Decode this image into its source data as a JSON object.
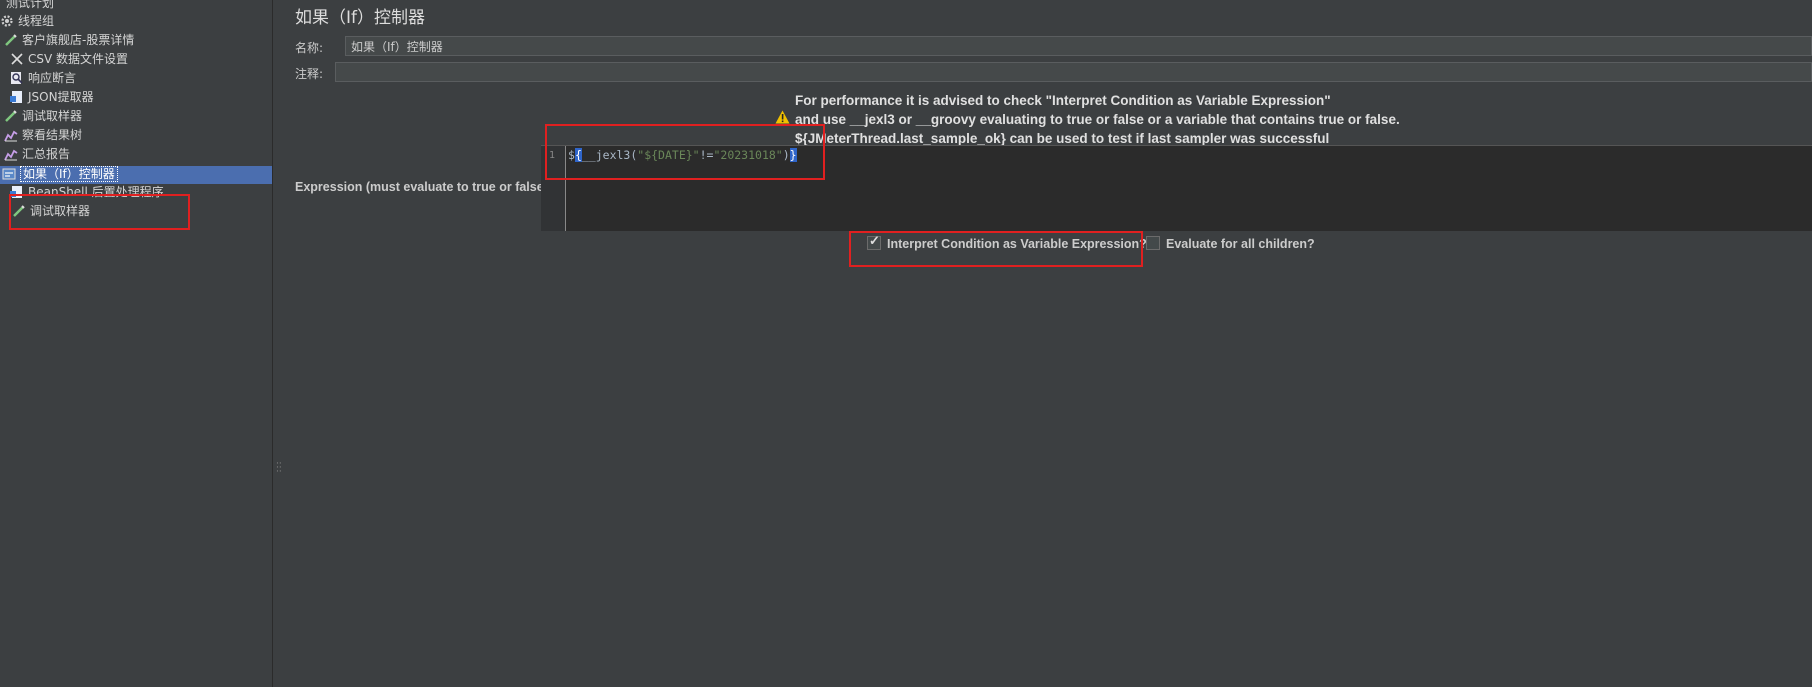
{
  "tree": {
    "items": [
      {
        "label": "测试计划",
        "icon": "test-plan-icon"
      },
      {
        "label": "线程组",
        "icon": "gear-icon"
      },
      {
        "label": "客户旗舰店-股票详情",
        "icon": "pipette-icon"
      },
      {
        "label": "CSV 数据文件设置",
        "icon": "scissors-icon"
      },
      {
        "label": "响应断言",
        "icon": "magnifier-icon"
      },
      {
        "label": "JSON提取器",
        "icon": "document-icon"
      },
      {
        "label": "调试取样器",
        "icon": "pipette-icon"
      },
      {
        "label": "察看结果树",
        "icon": "chart-icon"
      },
      {
        "label": "汇总报告",
        "icon": "chart-icon"
      },
      {
        "label": "如果（If）控制器",
        "icon": "if-controller-icon",
        "selected": true
      },
      {
        "label": "BeanShell 后置处理程序",
        "icon": "document-icon"
      },
      {
        "label": "调试取样器",
        "icon": "pipette-icon"
      }
    ]
  },
  "main": {
    "title": "如果（If）控制器",
    "name_label": "名称:",
    "name_value": "如果（If）控制器",
    "comment_label": "注释:",
    "comment_value": "",
    "advice_line1": "For performance it is advised to check \"Interpret Condition as Variable Expression\"",
    "advice_line2": "and use __jexl3 or __groovy evaluating to true or false or a variable that contains true or false.",
    "advice_line3": "${JMeterThread.last_sample_ok} can be used to test if last sampler was successful",
    "expression_label": "Expression (must evaluate to true or false)",
    "line_number": "1",
    "code": {
      "prefix": "$",
      "open_brace": "{",
      "func": "__jexl3(",
      "q1": "\"",
      "var": "${DATE}",
      "q2": "\"",
      "op": "!=",
      "q3": "\"",
      "literal": "20231018",
      "q4": "\"",
      "close_paren": ")",
      "close_brace": "}"
    },
    "checkbox_interpret": {
      "label": "Interpret Condition as Variable Expression?",
      "checked": true
    },
    "checkbox_children": {
      "label": "Evaluate for all children?",
      "checked": false
    }
  },
  "colors": {
    "accent": "#4b6eaf",
    "highlight_box": "#e02020",
    "background": "#3c3f41"
  }
}
